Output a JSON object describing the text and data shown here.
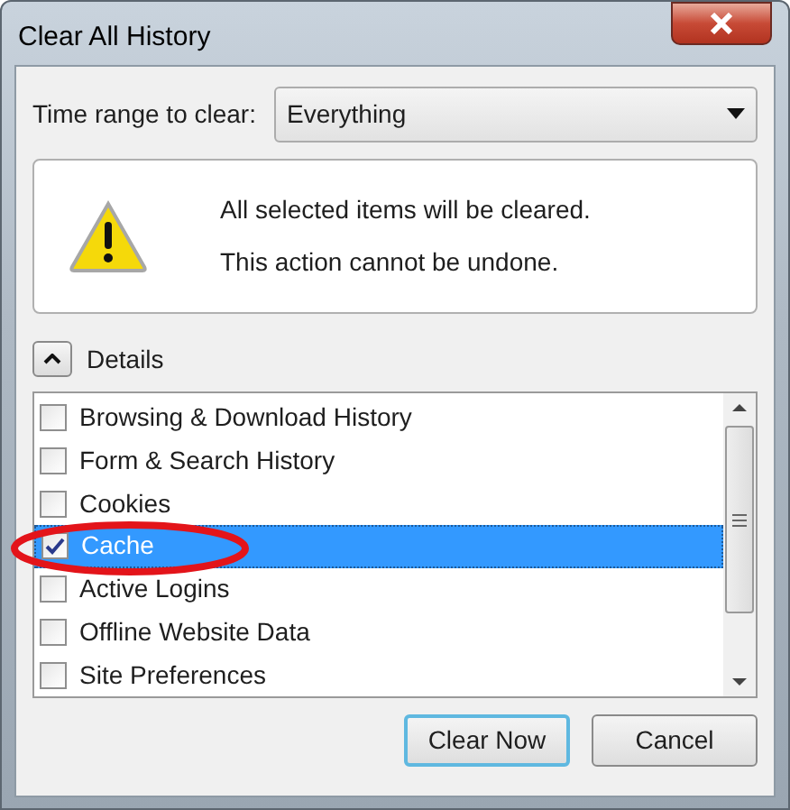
{
  "window": {
    "title": "Clear All History"
  },
  "time_range": {
    "label": "Time range to clear:",
    "value": "Everything"
  },
  "warning": {
    "lines": [
      "All selected items will be cleared.",
      "This action cannot be undone."
    ]
  },
  "details": {
    "label": "Details",
    "expanded": true
  },
  "items": [
    {
      "label": "Browsing & Download History",
      "checked": false,
      "selected": false
    },
    {
      "label": "Form & Search History",
      "checked": false,
      "selected": false
    },
    {
      "label": "Cookies",
      "checked": false,
      "selected": false
    },
    {
      "label": "Cache",
      "checked": true,
      "selected": true
    },
    {
      "label": "Active Logins",
      "checked": false,
      "selected": false
    },
    {
      "label": "Offline Website Data",
      "checked": false,
      "selected": false
    },
    {
      "label": "Site Preferences",
      "checked": false,
      "selected": false
    }
  ],
  "buttons": [
    {
      "label": "Clear Now",
      "default": true
    },
    {
      "label": "Cancel",
      "default": false
    }
  ]
}
